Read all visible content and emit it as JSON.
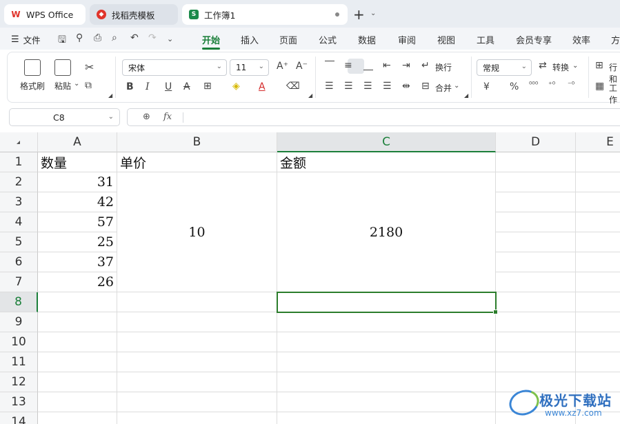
{
  "tabs": [
    {
      "label": "WPS Office",
      "icon": "wps-logo-icon"
    },
    {
      "label": "找稻壳模板",
      "icon": "docer-icon"
    },
    {
      "label": "工作簿1",
      "icon": "spreadsheet-icon"
    }
  ],
  "menu": {
    "file_label": "文件",
    "items": [
      "开始",
      "插入",
      "页面",
      "公式",
      "数据",
      "审阅",
      "视图",
      "工具",
      "会员专享",
      "效率",
      "方"
    ],
    "active": "开始"
  },
  "ribbon": {
    "format_painter": "格式刷",
    "paste": "粘贴",
    "font_name": "宋体",
    "font_size": "11",
    "wrap": "换行",
    "merge": "合并",
    "number_format": "常规",
    "convert": "转换",
    "rows_cols": "行和",
    "worksheet": "工作",
    "currency_symbol": "¥",
    "percent_symbol": "%"
  },
  "formula_bar": {
    "cell_ref": "C8",
    "fx_label": "fx",
    "content": ""
  },
  "grid": {
    "columns": [
      "A",
      "B",
      "C",
      "D",
      "E"
    ],
    "selected_column": "C",
    "rows": [
      "1",
      "2",
      "3",
      "4",
      "5",
      "6",
      "7",
      "8",
      "9",
      "10",
      "11",
      "12",
      "13",
      "14"
    ],
    "selected_row": "8",
    "cells": {
      "A1": "数量",
      "B1": "单价",
      "C1": "金额",
      "A2": "31",
      "A3": "42",
      "A4": "57",
      "A5": "25",
      "A6": "37",
      "A7": "26",
      "B2_merged": "10",
      "C2_merged": "2180"
    },
    "active_cell": "C8"
  },
  "watermark": {
    "title": "极光下载站",
    "url": "www.xz7.com"
  },
  "colors": {
    "accent": "#1b7f3a",
    "selection": "#2b7d2b"
  }
}
